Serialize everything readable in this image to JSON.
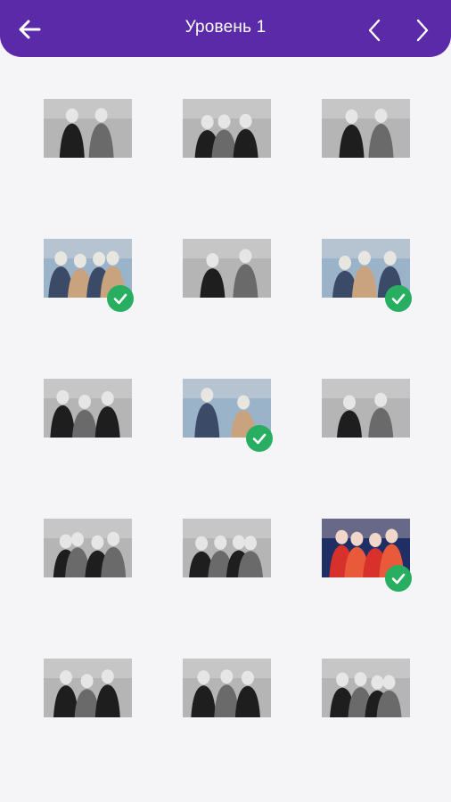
{
  "header": {
    "title": "Уровень 1",
    "back_icon": "arrow-left-icon",
    "prev_icon": "chevron-left-icon",
    "next_icon": "chevron-right-icon",
    "color": "#5a2aa8"
  },
  "level": {
    "completed_color": "#27ae60",
    "tiles": [
      {
        "id": 1,
        "solved": false,
        "tone": "bw"
      },
      {
        "id": 2,
        "solved": false,
        "tone": "bw"
      },
      {
        "id": 3,
        "solved": false,
        "tone": "bw"
      },
      {
        "id": 4,
        "solved": true,
        "tone": "color"
      },
      {
        "id": 5,
        "solved": false,
        "tone": "bw"
      },
      {
        "id": 6,
        "solved": true,
        "tone": "color"
      },
      {
        "id": 7,
        "solved": false,
        "tone": "bw"
      },
      {
        "id": 8,
        "solved": true,
        "tone": "color"
      },
      {
        "id": 9,
        "solved": false,
        "tone": "bw"
      },
      {
        "id": 10,
        "solved": false,
        "tone": "bw"
      },
      {
        "id": 11,
        "solved": false,
        "tone": "bw"
      },
      {
        "id": 12,
        "solved": true,
        "tone": "color-red"
      },
      {
        "id": 13,
        "solved": false,
        "tone": "bw"
      },
      {
        "id": 14,
        "solved": false,
        "tone": "bw"
      },
      {
        "id": 15,
        "solved": false,
        "tone": "bw"
      }
    ]
  }
}
